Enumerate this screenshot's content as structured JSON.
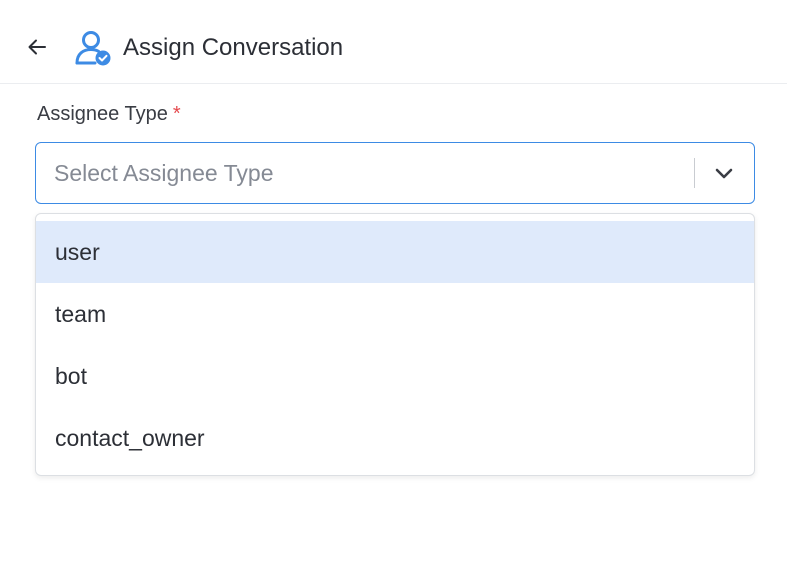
{
  "header": {
    "back_icon": "arrow-left-icon",
    "title_icon": "user-check-icon",
    "title": "Assign Conversation"
  },
  "form": {
    "assignee_type": {
      "label": "Assignee Type",
      "required_mark": "*",
      "placeholder": "Select Assignee Type",
      "chevron_icon": "chevron-down-icon",
      "options": [
        "user",
        "team",
        "bot",
        "contact_owner"
      ],
      "highlighted_option": "user"
    }
  },
  "colors": {
    "accent": "#3d8be4",
    "highlight": "#dfeafb",
    "required": "#e5484d"
  }
}
